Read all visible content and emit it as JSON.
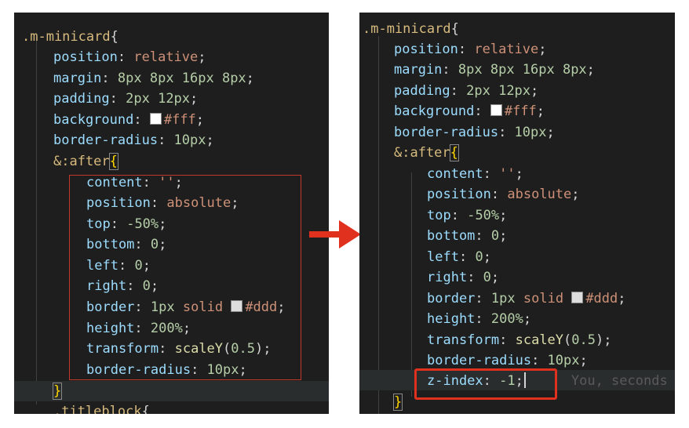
{
  "left": {
    "lines": [
      {
        "sel": ".m-minicard",
        "brace": "{"
      },
      {
        "prop": "position",
        "val": "relative"
      },
      {
        "prop": "margin",
        "num": "8px 8px 16px 8px"
      },
      {
        "prop": "padding",
        "num": "2px 12px"
      },
      {
        "prop": "background",
        "swatch": "#ffffff",
        "val": "#fff"
      },
      {
        "prop": "border-radius",
        "num": "10px"
      },
      {
        "sel": "&:after",
        "brace": "{"
      },
      {
        "prop": "content",
        "val": "''"
      },
      {
        "prop": "position",
        "val": "absolute"
      },
      {
        "prop": "top",
        "num": "-50%"
      },
      {
        "prop": "bottom",
        "num": "0"
      },
      {
        "prop": "left",
        "num": "0"
      },
      {
        "prop": "right",
        "num": "0"
      },
      {
        "prop": "border",
        "num": "1px",
        "val": "solid",
        "swatch": "#dddddd",
        "val2": "#ddd"
      },
      {
        "prop": "height",
        "num": "200%"
      },
      {
        "prop": "transform",
        "fn": "scaleY",
        "num": "0.5"
      },
      {
        "prop": "border-radius",
        "num": "10px"
      },
      {
        "brace": "}"
      },
      {
        "sel": ".titleblock",
        "brace": "{"
      }
    ]
  },
  "right": {
    "lines": [
      {
        "sel": ".m-minicard",
        "brace": "{"
      },
      {
        "prop": "position",
        "val": "relative"
      },
      {
        "prop": "margin",
        "num": "8px 8px 16px 8px"
      },
      {
        "prop": "padding",
        "num": "2px 12px"
      },
      {
        "prop": "background",
        "swatch": "#ffffff",
        "val": "#fff"
      },
      {
        "prop": "border-radius",
        "num": "10px"
      },
      {
        "sel": "&:after",
        "brace": "{"
      },
      {
        "prop": "content",
        "val": "''"
      },
      {
        "prop": "position",
        "val": "absolute"
      },
      {
        "prop": "top",
        "num": "-50%"
      },
      {
        "prop": "bottom",
        "num": "0"
      },
      {
        "prop": "left",
        "num": "0"
      },
      {
        "prop": "right",
        "num": "0"
      },
      {
        "prop": "border",
        "num": "1px",
        "val": "solid",
        "swatch": "#dddddd",
        "val2": "#ddd"
      },
      {
        "prop": "height",
        "num": "200%"
      },
      {
        "prop": "transform",
        "fn": "scaleY",
        "num": "0.5"
      },
      {
        "prop": "border-radius",
        "num": "10px"
      },
      {
        "prop": "z-index",
        "num": "-1"
      },
      {
        "brace": "}"
      }
    ],
    "ghost_text": "You, seconds"
  },
  "colors": {
    "editor_bg": "#1e1e1e",
    "highlight_box": "#c0392b",
    "arrow": "#e0301e"
  }
}
